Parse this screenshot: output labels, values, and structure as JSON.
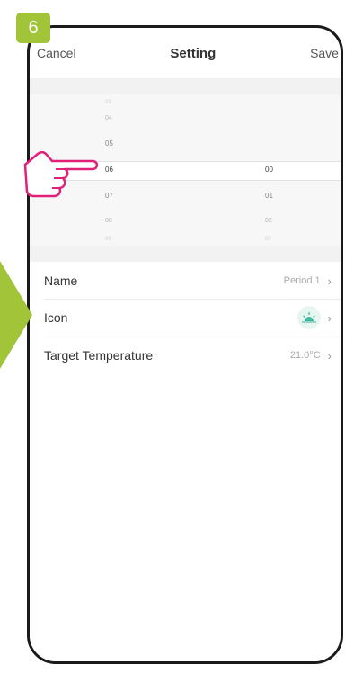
{
  "step": {
    "number": "6"
  },
  "navbar": {
    "cancel_label": "Cancel",
    "title": "Setting",
    "save_label": "Save"
  },
  "picker": {
    "hours": [
      "03",
      "04",
      "05",
      "06",
      "07",
      "08",
      "09"
    ],
    "minutes": [
      "00",
      "01",
      "02",
      "03"
    ],
    "selected_hour": "06",
    "selected_minute": "00"
  },
  "settings": {
    "name": {
      "label": "Name",
      "value": "Period 1"
    },
    "icon": {
      "label": "Icon",
      "icon_name": "sunrise-icon"
    },
    "target_temperature": {
      "label": "Target Temperature",
      "value": "21.0°C"
    }
  },
  "colors": {
    "badge_green": "#a2c438",
    "hand_pink": "#e0217a",
    "icon_teal": "#3bb89a"
  },
  "icons": [
    "hand-pointer-icon",
    "arrow-right-icon",
    "sunrise-icon",
    "chevron-right-icon"
  ]
}
